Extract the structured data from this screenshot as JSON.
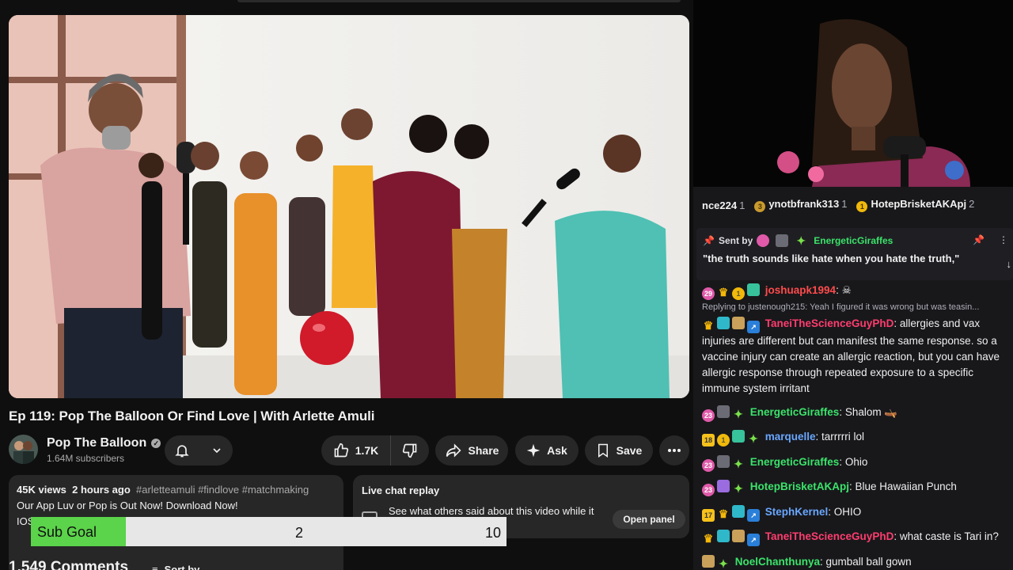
{
  "video": {
    "title": "Ep 119: Pop The Balloon Or Find Love | With Arlette Amuli"
  },
  "channel": {
    "name": "Pop The Balloon",
    "subscribers": "1.64M subscribers"
  },
  "actions": {
    "likes": "1.7K",
    "share_label": "Share",
    "ask_label": "Ask",
    "save_label": "Save"
  },
  "description": {
    "views": "45K views",
    "age": "2 hours ago",
    "tags": "#arletteamuli #findlove #matchmaking",
    "line1": "Our App Luv or Pop is Out Now! Download Now!",
    "line2": "IOS:"
  },
  "live_chat_replay": {
    "title": "Live chat replay",
    "text": "See what others said about this video while it",
    "open_label": "Open panel"
  },
  "comments": {
    "count_label": "1,549 Comments",
    "sort_label": "Sort by"
  },
  "sub_goal": {
    "label": "Sub Goal",
    "current": "2",
    "target": "10",
    "progress_fraction": 0.2
  },
  "stream_chat": {
    "leaderboard": [
      {
        "name": "nce224",
        "rank": "1"
      },
      {
        "name": "ynotbfrank313",
        "rank": "1"
      },
      {
        "name": "HotepBrisketAKApj",
        "rank": "2"
      }
    ],
    "pinned": {
      "sent_by_label": "Sent by",
      "user": "EnergeticGiraffes",
      "message": "\"the truth sounds like hate when you hate the truth,\""
    },
    "messages": [
      {
        "user": "joshuapk1994",
        "color": "#ff4b4b",
        "text": ""
      },
      {
        "reply": "Replying to justenough215: Yeah I figured it was wrong but was teasin..."
      },
      {
        "user": "TaneiTheScienceGuyPhD",
        "color": "#ff3d6e",
        "text": ": allergies and vax injuries are different but can manifest the same response. so a vaccine injury can create an allergic reaction, but you can have allergic response through repeated exposure to a specific immune system irritant"
      },
      {
        "user": "EnergeticGiraffes",
        "color": "#3be36a",
        "text": ": Shalom"
      },
      {
        "user": "marquelle",
        "color": "#6aa7ff",
        "text": ": tarrrrri lol"
      },
      {
        "user": "EnergeticGiraffes",
        "color": "#3be36a",
        "text": ": Ohio"
      },
      {
        "user": "HotepBrisketAKApj",
        "color": "#3be36a",
        "text": ": Blue Hawaiian Punch"
      },
      {
        "user": "StephKernel",
        "color": "#6aa7ff",
        "text": ": OHIO"
      },
      {
        "user": "TaneiTheScienceGuyPhD",
        "color": "#ff3d6e",
        "text": ": what caste is Tari in?"
      },
      {
        "user": "NoelChanthunya",
        "color": "#3be36a",
        "text": ": gumball ball gown"
      }
    ],
    "badges": {
      "b1": "29",
      "b2": "18",
      "b3": "23",
      "b4": "17"
    }
  },
  "icons": [
    "bell-icon",
    "chevron-down-icon",
    "thumbs-up-icon",
    "thumbs-down-icon",
    "share-icon",
    "sparkle-icon",
    "bookmark-icon",
    "more-icon",
    "pin-icon",
    "verified-icon"
  ]
}
